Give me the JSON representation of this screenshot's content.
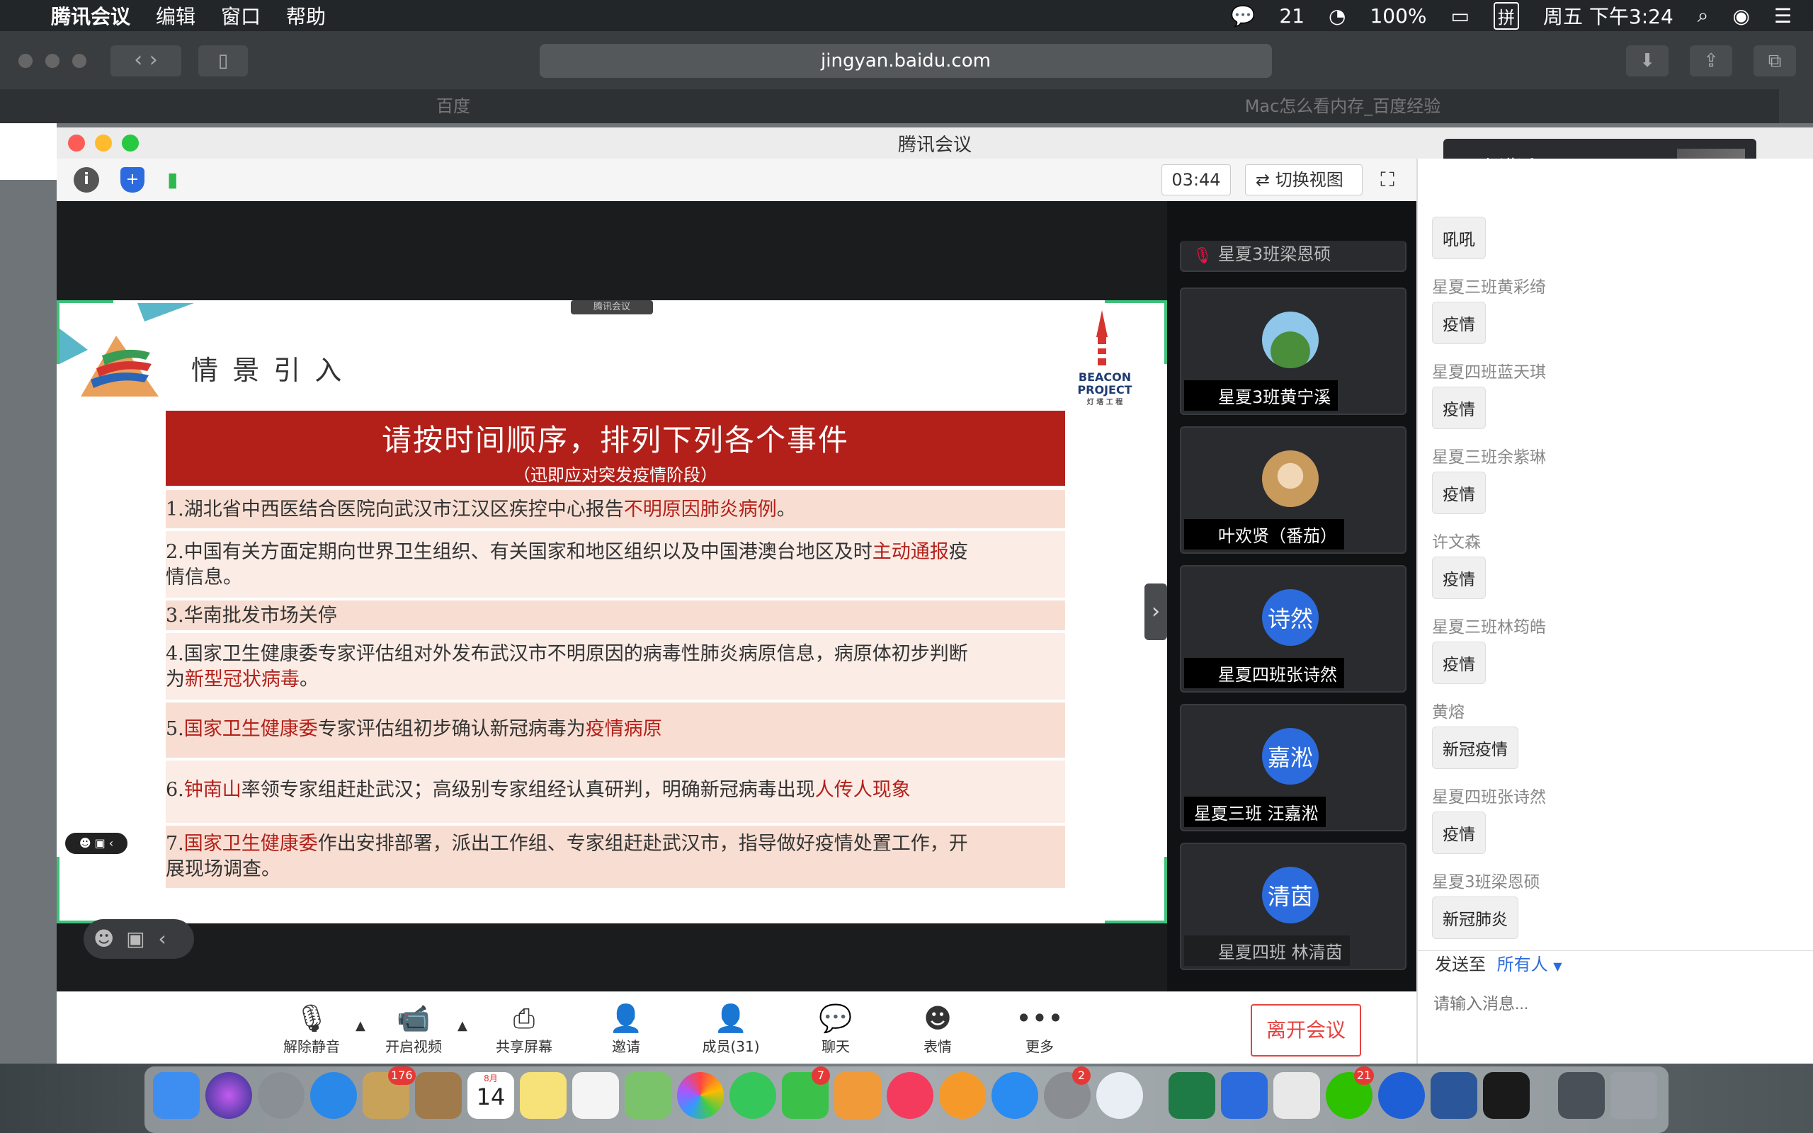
{
  "menubar": {
    "app_name": "腾讯会议",
    "menus": [
      "编辑",
      "窗口",
      "帮助"
    ],
    "wechat_count": "21",
    "battery": "100%",
    "input_method": "拼",
    "clock": "周五 下午3:24"
  },
  "browser": {
    "url": "jingyan.baidu.com",
    "tab_left": "百度",
    "tab_right": "Mac怎么看内存_百度经验"
  },
  "meeting": {
    "window_title": "腾讯会议",
    "timer": "03:44",
    "switch_view_label": "切换视图",
    "speaking_label": "正在讲话:",
    "watermark_label": "腾讯会议"
  },
  "slide": {
    "title": "情 景 引 入",
    "banner_main": "请按时间顺序，排列下列各个事件",
    "banner_sub": "（迅即应对突发疫情阶段）",
    "logo_text_1": "BEACON",
    "logo_text_2": "PROJECT",
    "logo_text_3": "灯 塔 工 程",
    "rows": [
      {
        "a": "1.湖北省中西医结合医院向武汉市江汉区疾控中心报告",
        "b": "不明原因肺炎病例",
        "c": "。"
      },
      {
        "a": "2.中国有关方面定期向世界卫生组织、有关国家和地区组织以及中国港澳台地区及时",
        "b": "主动通报",
        "c": "疫",
        "d": "情信息。"
      },
      {
        "a": "3.华南批发市场关停"
      },
      {
        "a": "4.国家卫生健康委专家评估组对外发布武汉市不明原因的病毒性肺炎病原信息，病原体初步判断",
        "d_a": "为",
        "b": "新型冠状病毒",
        "c": "。"
      },
      {
        "a": "5.",
        "b": "国家卫生健康委",
        "c": "专家评估组初步确认新冠病毒为",
        "d": "疫情病原"
      },
      {
        "a": "6.",
        "b": "钟南山",
        "c": "率领专家组赶赴武汉；高级别专家组经认真研判，明确新冠病毒出现",
        "d": "人传人现象"
      },
      {
        "a": "7.",
        "b": "国家卫生健康委",
        "c": "作出安排部署，派出工作组、专家组赶赴武汉市，指导做好疫情处置工作，开",
        "d": "展现场调查。"
      }
    ]
  },
  "gallery": [
    {
      "name": "星夏3班梁恩硕",
      "avatar": ""
    },
    {
      "name": "星夏3班黄宁溪",
      "avatar": ""
    },
    {
      "name": "叶欢贤（番茄）",
      "avatar": ""
    },
    {
      "name": "星夏四班张诗然",
      "avatar": "诗然"
    },
    {
      "name": "星夏三班 汪嘉淞",
      "avatar": "嘉淞"
    },
    {
      "name": "星夏四班 林清茵",
      "avatar": "清茵"
    }
  ],
  "chat": {
    "messages": [
      {
        "name": "",
        "text": "吼吼"
      },
      {
        "name": "星夏三班黄彩绮",
        "text": "疫情"
      },
      {
        "name": "星夏四班蓝天琪",
        "text": "疫情"
      },
      {
        "name": "星夏三班余紫琳",
        "text": "疫情"
      },
      {
        "name": "许文森",
        "text": "疫情"
      },
      {
        "name": "星夏三班林筠皓",
        "text": "疫情"
      },
      {
        "name": "黄熔",
        "text": "新冠疫情"
      },
      {
        "name": "星夏四班张诗然",
        "text": "疫情"
      },
      {
        "name": "星夏3班梁恩硕",
        "text": "新冠肺炎"
      }
    ],
    "send_to_label": "发送至",
    "send_to_value": "所有人",
    "input_placeholder": "请输入消息..."
  },
  "controls": {
    "unmute": "解除静音",
    "start_video": "开启视频",
    "share_screen": "共享屏幕",
    "invite": "邀请",
    "members": "成员(31)",
    "chat": "聊天",
    "reactions": "表情",
    "more": "更多",
    "leave": "离开会议"
  },
  "dock": {
    "mail_badge": "176",
    "calendar_month": "8月",
    "calendar_day": "14",
    "facetime_badge": "7",
    "settings_badge": "2",
    "wechat_badge": "21"
  },
  "colors": {
    "banner_red": "#b3201a",
    "highlight_red": "#b3201a",
    "accent_blue": "#2c6bde",
    "leave_red": "#e64340"
  }
}
